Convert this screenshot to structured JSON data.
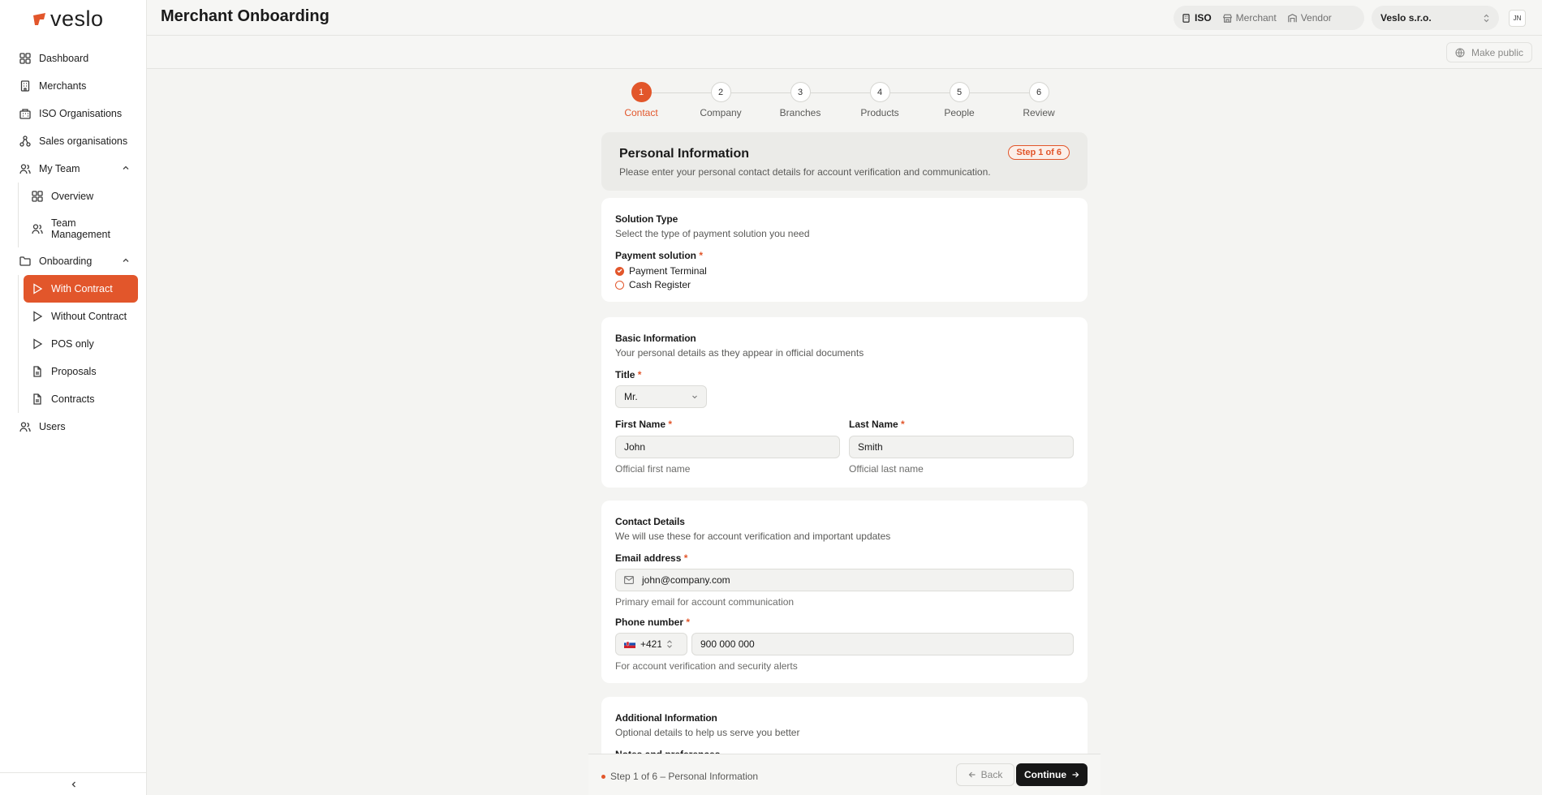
{
  "app": {
    "logo_text": "veslo",
    "page_title": "Merchant Onboarding"
  },
  "colors": {
    "accent": "#e2562b",
    "primary_button": "#171717"
  },
  "sidebar": {
    "items": [
      {
        "label": "Dashboard",
        "icon": "dashboard-icon"
      },
      {
        "label": "Merchants",
        "icon": "building-icon"
      },
      {
        "label": "ISO Organisations",
        "icon": "organisation-icon"
      },
      {
        "label": "Sales organisations",
        "icon": "network-icon"
      },
      {
        "label": "My Team",
        "icon": "users-icon"
      },
      {
        "label": "Onboarding",
        "icon": "folder-icon"
      },
      {
        "label": "Users",
        "icon": "users-icon"
      }
    ],
    "team_sub": [
      {
        "label": "Overview",
        "icon": "dashboard-icon"
      },
      {
        "label": "Team Management",
        "icon": "users-icon"
      }
    ],
    "onboarding_sub": [
      {
        "label": "With Contract",
        "icon": "play-icon"
      },
      {
        "label": "Without Contract",
        "icon": "play-icon"
      },
      {
        "label": "POS only",
        "icon": "play-icon"
      },
      {
        "label": "Proposals",
        "icon": "file-icon"
      },
      {
        "label": "Contracts",
        "icon": "file-icon"
      }
    ]
  },
  "header": {
    "roles": [
      "ISO",
      "Merchant",
      "Vendor"
    ],
    "selected_role": "ISO",
    "org": "Veslo s.r.o.",
    "avatar_initials": "JN",
    "make_public": "Make public"
  },
  "stepper": {
    "current": 1,
    "steps": [
      {
        "num": "1",
        "label": "Contact"
      },
      {
        "num": "2",
        "label": "Company"
      },
      {
        "num": "3",
        "label": "Branches"
      },
      {
        "num": "4",
        "label": "Products"
      },
      {
        "num": "5",
        "label": "People"
      },
      {
        "num": "6",
        "label": "Review"
      }
    ]
  },
  "intro": {
    "title": "Personal Information",
    "subtitle": "Please enter your personal contact details for account verification and communication.",
    "badge": "Step 1 of 6"
  },
  "solution": {
    "title": "Solution Type",
    "subtitle": "Select the type of payment solution you need",
    "field_label": "Payment solution",
    "options": [
      "Payment Terminal",
      "Cash Register"
    ],
    "selected": "Payment Terminal"
  },
  "basic": {
    "title": "Basic Information",
    "subtitle": "Your personal details as they appear in official documents",
    "title_label": "Title",
    "title_value": "Mr.",
    "first_label": "First Name",
    "first_value": "John",
    "first_hint": "Official first name",
    "last_label": "Last Name",
    "last_value": "Smith",
    "last_hint": "Official last name"
  },
  "contact": {
    "title": "Contact Details",
    "subtitle": "We will use these for account verification and important updates",
    "email_label": "Email address",
    "email_value": "john@company.com",
    "email_hint": "Primary email for account communication",
    "phone_label": "Phone number",
    "phone_code": "+421",
    "phone_value": "900 000 000",
    "phone_hint": "For account verification and security alerts"
  },
  "additional": {
    "title": "Additional Information",
    "subtitle": "Optional details to help us serve you better",
    "notes_label": "Notes and preferences"
  },
  "footer": {
    "status": "Step 1 of 6 – Personal Information",
    "back": "Back",
    "continue": "Continue"
  }
}
